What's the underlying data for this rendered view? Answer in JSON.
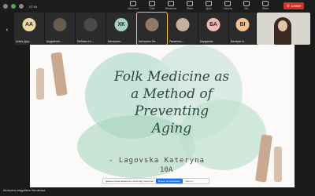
{
  "window": {
    "timer": "27:16"
  },
  "toolbar": {
    "items": [
      {
        "label": "Ask Lead",
        "icon": "dots-icon"
      },
      {
        "label": "Chat",
        "icon": "chat-icon"
      },
      {
        "label": "Reactions",
        "icon": "reactions-icon"
      },
      {
        "label": "Share",
        "icon": "share-icon"
      },
      {
        "label": "Apps",
        "icon": "apps-icon"
      },
      {
        "label": "Camera",
        "icon": "camera-icon"
      },
      {
        "label": "Mic",
        "icon": "mic-icon"
      },
      {
        "label": "Share",
        "icon": "share-screen-icon"
      }
    ],
    "leave_label": "Leave"
  },
  "participants": [
    {
      "initials": "АА",
      "name": "Аліна Дор...",
      "color": "#f2d6a2"
    },
    {
      "initials": "",
      "name": "Андрійчен...",
      "color": "#6b5b4a"
    },
    {
      "initials": "",
      "name": "Рябова Ал...",
      "color": "#4a4a4a"
    },
    {
      "initials": "ХК",
      "name": "Катерина...",
      "color": "#a7d3c2"
    },
    {
      "initials": "",
      "name": "Катерина Ла...",
      "color": "#8f7a6a"
    },
    {
      "initials": "",
      "name": "Яковенко...",
      "color": "#c4b29c"
    },
    {
      "initials": "БА",
      "name": "Бардаков...",
      "color": "#f0b7b7"
    },
    {
      "initials": "ВІ",
      "name": "Валерія Іс...",
      "color": "#f4c28a"
    }
  ],
  "slide": {
    "title_lines": [
      "Folk Medicine as",
      "a Method of",
      "Preventing",
      "Aging"
    ],
    "author": "- Lagovska Kateryna",
    "class_name": "10A"
  },
  "notice": {
    "text": "Демонстрація екрана для перегляду пристрою",
    "button": "Більше не показувати",
    "link": "Закрити"
  },
  "speaker": "Катерина Андріївна Лаговська"
}
